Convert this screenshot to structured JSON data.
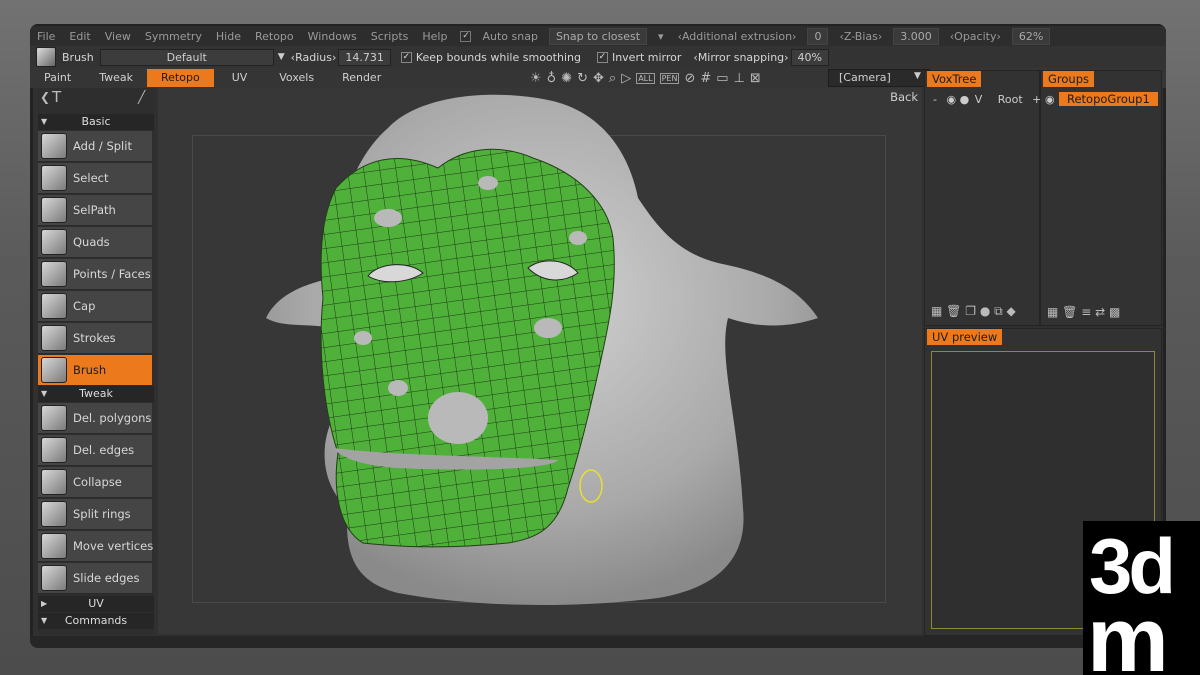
{
  "menubar": {
    "items": [
      "File",
      "Edit",
      "View",
      "Symmetry",
      "Hide",
      "Retopo",
      "Windows",
      "Scripts",
      "Help"
    ],
    "auto_snap": "Auto snap",
    "snap_mode": "Snap to closest",
    "additional_extrusion_label": "‹Additional extrusion›",
    "additional_extrusion_value": "0",
    "zbias_label": "‹Z-Bias›",
    "zbias_value": "3.000",
    "opacity_label": "‹Opacity›",
    "opacity_value": "62%"
  },
  "toolbar": {
    "tool_name": "Brush",
    "preset": "Default",
    "radius_label": "‹Radius›",
    "radius_value": "14.731",
    "keep_bounds": "Keep bounds while smoothing",
    "invert_mirror": "Invert mirror",
    "mirror_snapping_label": "‹Mirror snapping›",
    "mirror_snapping_value": "40%"
  },
  "tabs": [
    {
      "label": "Paint",
      "active": false
    },
    {
      "label": "Tweak",
      "active": false
    },
    {
      "label": "Retopo",
      "active": true
    },
    {
      "label": "UV",
      "active": false
    },
    {
      "label": "Voxels",
      "active": false
    },
    {
      "label": "Render",
      "active": false
    }
  ],
  "view_icons": [
    "light-icon",
    "bulb-icon",
    "sun-icon",
    "rotate-icon",
    "move-icon",
    "zoom-icon",
    "play-icon",
    "all-icon",
    "pen-icon",
    "no-icon",
    "grid-icon",
    "frame-icon",
    "axis-icon",
    "fit-icon"
  ],
  "camera": "[Camera]",
  "back": "Back",
  "left_panel": {
    "sections": {
      "basic": "Basic",
      "tweak": "Tweak",
      "uv": "UV",
      "commands": "Commands"
    },
    "basic_tools": [
      "Add / Split",
      "Select",
      "SelPath",
      "Quads",
      "Points / Faces",
      "Cap",
      "Strokes",
      "Brush"
    ],
    "tweak_tools": [
      "Del. polygons",
      "Del. edges",
      "Collapse",
      "Split rings",
      "Move vertices",
      "Slide edges"
    ],
    "active_tool": "Brush"
  },
  "voxtree": {
    "title": "VoxTree",
    "root": "Root",
    "visibility": "V"
  },
  "groups": {
    "title": "Groups",
    "item": "RetopoGroup1"
  },
  "uv_preview": {
    "title": "UV preview"
  },
  "logo": {
    "text": "3dm"
  },
  "colors": {
    "accent": "#ec7a1c",
    "mesh_green": "#4fb13a",
    "sculpt_gray": "#b9b9b9"
  }
}
